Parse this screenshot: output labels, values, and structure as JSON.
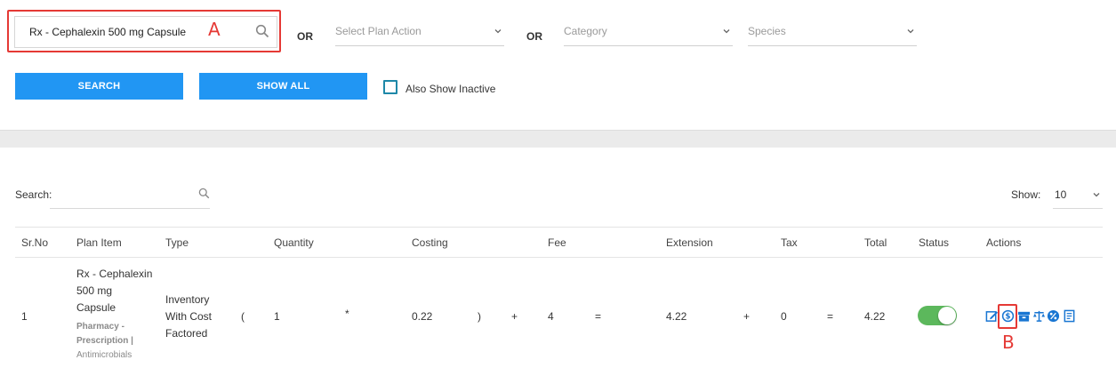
{
  "filters": {
    "search_value": "Rx - Cephalexin 500 mg Capsule",
    "or_label": "OR",
    "plan_action_placeholder": "Select Plan Action",
    "category_placeholder": "Category",
    "species_placeholder": "Species",
    "search_button": "SEARCH",
    "show_all_button": "SHOW ALL",
    "inactive_label": "Also Show Inactive"
  },
  "annotations": {
    "marker_a": "A",
    "marker_b": "B"
  },
  "table_controls": {
    "search_label": "Search:",
    "show_label": "Show:",
    "show_value": "10"
  },
  "table": {
    "headers": [
      "Sr.No",
      "Plan Item",
      "Type",
      "Quantity",
      "Costing",
      "Fee",
      "Extension",
      "Tax",
      "Total",
      "Status",
      "Actions"
    ],
    "row": {
      "sr": "1",
      "item_line1": "Rx - Cephalexin",
      "item_line2": "500 mg",
      "item_line3": "Capsule",
      "sub_line1": "Pharmacy -",
      "sub_line2": "Prescription |",
      "sub_line3": "Antimicrobials",
      "type_line1": "Inventory",
      "type_line2": "With Cost",
      "type_line3": "Factored",
      "open_paren": "(",
      "quantity": "1",
      "times": "*",
      "costing": "0.22",
      "close_paren": ")",
      "plus1": "+",
      "fee": "4",
      "equals1": "=",
      "extension": "4.22",
      "plus2": "+",
      "tax": "0",
      "equals2": "=",
      "total": "4.22",
      "status_on": true
    },
    "actions": [
      "edit-icon",
      "dollar-icon",
      "inventory-icon",
      "scale-icon",
      "percent-icon",
      "document-icon"
    ]
  },
  "colors": {
    "primary": "#2196f3",
    "annotation": "#e53935",
    "toggle_on": "#5cb85c",
    "action_icon": "#1976d2"
  }
}
